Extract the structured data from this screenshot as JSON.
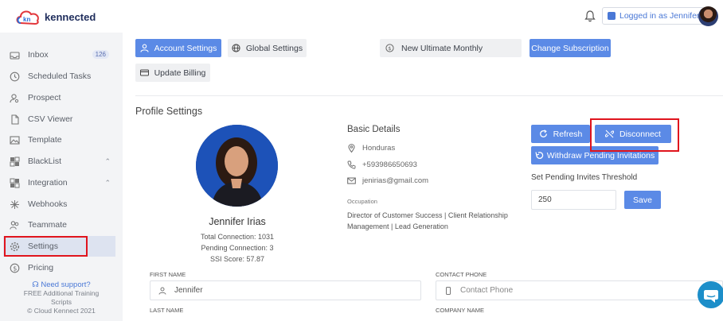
{
  "brand": {
    "name": "kennected",
    "logo_letters": "kn"
  },
  "header": {
    "logged_in": "Logged in as Jennifer"
  },
  "sidebar": {
    "items": [
      {
        "label": "Inbox",
        "badge": "126",
        "icon": "inbox-icon"
      },
      {
        "label": "Scheduled Tasks",
        "icon": "clock-icon"
      },
      {
        "label": "Prospect",
        "icon": "user-search-icon"
      },
      {
        "label": "CSV Viewer",
        "icon": "file-icon"
      },
      {
        "label": "Template",
        "icon": "image-icon"
      },
      {
        "label": "BlackList",
        "icon": "blacklist-icon",
        "expandable": true
      },
      {
        "label": "Integration",
        "icon": "layers-icon",
        "expandable": true
      },
      {
        "label": "Webhooks",
        "icon": "webhook-icon"
      },
      {
        "label": "Teammate",
        "icon": "teammate-icon"
      },
      {
        "label": "Settings",
        "icon": "gear-icon",
        "active": true
      },
      {
        "label": "Pricing",
        "icon": "dollar-icon"
      }
    ],
    "support": {
      "link": "Need support?",
      "line1": "FREE Additional Training",
      "line2": "Scripts",
      "copyright": "© Cloud Kennect 2021"
    }
  },
  "toolbar": {
    "account_settings": "Account Settings",
    "global_settings": "Global Settings",
    "plan": "New Ultimate Monthly",
    "change_subscription": "Change Subscription",
    "update_billing": "Update Billing"
  },
  "profile": {
    "section_title": "Profile Settings",
    "name": "Jennifer Irias",
    "total_connection": "Total Connection: 1031",
    "pending_connection": "Pending Connection: 3",
    "ssi_score": "SSI Score: 57.87"
  },
  "basic_details": {
    "title": "Basic Details",
    "location": "Honduras",
    "phone": "+593986650693",
    "email": "jenirias@gmail.com",
    "occupation_label": "Occupation",
    "occupation": "Director of Customer Success | Client Relationship Management | Lead Generation"
  },
  "actions": {
    "refresh": "Refresh",
    "disconnect": "Disconnect",
    "withdraw": "Withdraw Pending Invitations",
    "threshold_label": "Set Pending Invites Threshold",
    "threshold_value": "250",
    "save": "Save"
  },
  "form": {
    "first_name_label": "FIRST NAME",
    "first_name_value": "Jennifer",
    "contact_phone_label": "CONTACT PHONE",
    "contact_phone_placeholder": "Contact Phone",
    "last_name_label": "LAST NAME",
    "company_name_label": "COMPANY NAME"
  },
  "colors": {
    "primary": "#5b8ae6",
    "highlight": "#e0141d",
    "chat": "#1c8ec9"
  }
}
